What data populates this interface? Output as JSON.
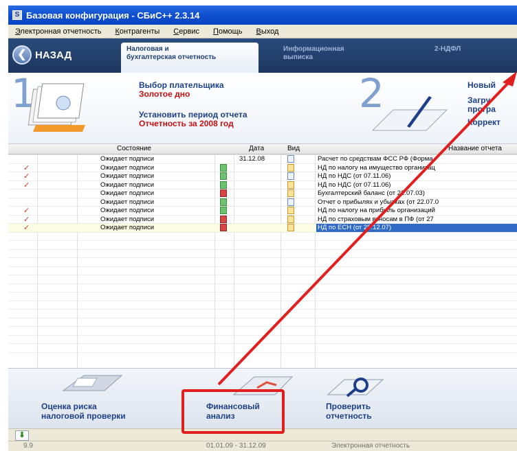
{
  "window": {
    "title": "Базовая конфигурация - СБиС++ 2.3.14"
  },
  "menu": [
    "Электронная отчетность",
    "Контрагенты",
    "Сервис",
    "Помощь",
    "Выход"
  ],
  "nav": {
    "back_label": "НАЗАД",
    "tabs": [
      {
        "line1": "Налоговая и",
        "line2": "бухгалтерская отчетность"
      },
      {
        "line1": "Информационная",
        "line2": "выписка"
      },
      {
        "line1": "2-НДФЛ",
        "line2": ""
      }
    ]
  },
  "steps": {
    "step1_number": "1",
    "payer_label": "Выбор плательщика",
    "payer_value": "Золотое дно",
    "period_label": "Установить период отчета",
    "period_value": "Отчетность за 2008 год",
    "step2_number": "2",
    "new_label": "Новый",
    "load_label": "Загру",
    "program_label": "програ",
    "correct_label": "Коррект"
  },
  "table": {
    "headers": {
      "status": "Состояние",
      "date": "Дата",
      "type": "Вид",
      "name": "Название отчета"
    },
    "rows": [
      {
        "mark": "",
        "status": "Ожидает подписи",
        "sign": "",
        "date": "31.12.08",
        "type": "doc",
        "name": "Расчет по средствам ФСС РФ (Форма"
      },
      {
        "mark": "✓",
        "status": "Ожидает подписи",
        "sign": "g",
        "date": "",
        "type": "y",
        "name": "НД по налогу на имущество организац"
      },
      {
        "mark": "✓",
        "status": "Ожидает подписи",
        "sign": "g",
        "date": "",
        "type": "doc",
        "name": "НД по НДС (от 07.11.06)"
      },
      {
        "mark": "✓",
        "status": "Ожидает подписи",
        "sign": "g",
        "date": "",
        "type": "y",
        "name": "НД по НДС (от 07.11.06)"
      },
      {
        "mark": "",
        "status": "Ожидает подписи",
        "sign": "r",
        "date": "",
        "type": "y",
        "name": "Бухгалтерский баланс (от 22.07.03)"
      },
      {
        "mark": "",
        "status": "Ожидает подписи",
        "sign": "g",
        "date": "",
        "type": "doc",
        "name": "Отчет о прибылях и убытках (от 22.07.0"
      },
      {
        "mark": "✓",
        "status": "Ожидает подписи",
        "sign": "g",
        "date": "",
        "type": "y",
        "name": "НД по налогу на прибыль организаций"
      },
      {
        "mark": "✓",
        "status": "Ожидает подписи",
        "sign": "r",
        "date": "",
        "type": "y",
        "name": "НД по страховым взносам в ПФ (от 27"
      },
      {
        "mark": "✓",
        "status": "Ожидает подписи",
        "sign": "r",
        "date": "",
        "type": "y",
        "name": "НД по ЕСН (от 29.12.07)"
      }
    ]
  },
  "actions": [
    {
      "line1": "Оценка риска",
      "line2": "налоговой проверки"
    },
    {
      "line1": "Финансовый",
      "line2": "анализ"
    },
    {
      "line1": "Проверить",
      "line2": "отчетность"
    }
  ],
  "statusbar": {
    "left": "9.9",
    "period": "01.01.09 - 31.12.09",
    "mode": "Электронная отчетность"
  },
  "colors": {
    "annotation": "#e31e1e",
    "title_bar": "#0e4fd0",
    "selection": "#316ac5"
  }
}
